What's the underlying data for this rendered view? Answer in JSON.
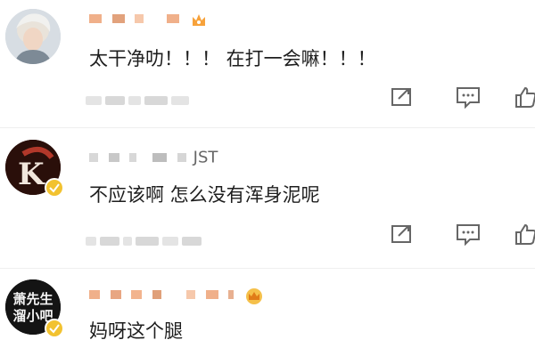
{
  "comments": [
    {
      "avatar_icon": "user-avatar",
      "text": "太干净叻！！！ 在打一会嘛！！！",
      "name_suffix": "",
      "badge_icon": "vip-crown-icon",
      "has_verified_badge": false
    },
    {
      "avatar_icon": "k-logo-avatar",
      "avatar_text": "K",
      "text": "不应该啊 怎么没有浑身泥呢",
      "name_suffix": "JST",
      "badge_icon": "",
      "has_verified_badge": true
    },
    {
      "avatar_icon": "text-avatar",
      "avatar_text_line1": "萧先生",
      "avatar_text_line2": "溜小吧",
      "text": "妈呀这个腿",
      "name_suffix": "",
      "badge_icon": "vip-crown-icon",
      "has_verified_badge": true
    }
  ],
  "actions": {
    "share_icon": "share-icon",
    "comment_icon": "comment-icon",
    "like_icon": "like-icon"
  },
  "colors": {
    "accent_orange": "#f7a23b",
    "badge_yellow": "#f2c230",
    "icon_gray": "#666666"
  }
}
